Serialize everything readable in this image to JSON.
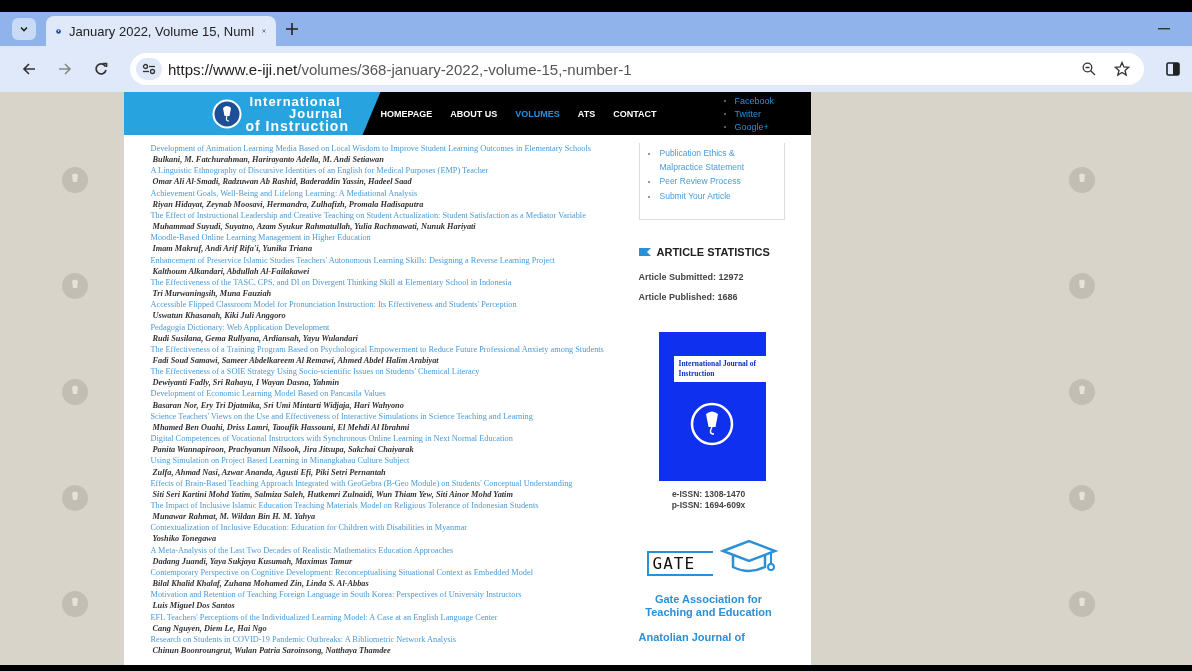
{
  "browser": {
    "tab_title": "January 2022, Volume 15, Numl",
    "url_host": "https://www.e-iji.net",
    "url_path": "/volumes/368-january-2022,-volume-15,-number-1"
  },
  "header": {
    "logo_lines": [
      "International",
      "Journal",
      "of Instruction"
    ],
    "nav": [
      {
        "label": "HOMEPAGE",
        "selected": false
      },
      {
        "label": "ABOUT US",
        "selected": false
      },
      {
        "label": "VOLUMES",
        "selected": true
      },
      {
        "label": "ATS",
        "selected": false
      },
      {
        "label": "CONTACT",
        "selected": false
      }
    ],
    "social": [
      "Facebook",
      "Twitter",
      "Google+"
    ]
  },
  "articles": [
    {
      "title": "Development of Animation Learning Media Based on Local Wisdom to Improve Student Learning Outcomes in Elementary Schools",
      "authors": "Bulkani, M. Fatchurahman, Harirayanto Adella, M. Andi Setiawan"
    },
    {
      "title": "A Linguistic Ethnography of Discursive Identities of an English for Medical Purposes (EMP) Teacher",
      "authors": "Omar Ali Al-Smadi, Radzuwan Ab Rashid, Baderaddin Yassin, Hadeel Saad"
    },
    {
      "title": "Achievement Goals, Well-Being and Lifelong Learning: A Mediational Analysis",
      "authors": "Riyan Hidayat, Zeynab Moosavi, Hermandra, Zulhafizh, Promala Hadisaputra"
    },
    {
      "title": "The Effect of Instructional Leadership and Creative Teaching on Student Actualization: Student Satisfaction as a Mediator Variable",
      "authors": "Muhammad Suyudi, Suyatno, Azam Syukur Rahmatullah, Yulia Rachmawati, Nunuk Hariyati"
    },
    {
      "title": "Moodle-Based Online Learning Management in Higher Education",
      "authors": "Imam Makruf, Andi Arif Rifa'i, Yunika Triana"
    },
    {
      "title": "Enhancement of Preservice Islamic Studies Teachers' Autonomous Learning Skills: Designing a Reverse Learning Project",
      "authors": "Kalthoum Alkandari, Abdullah Al-Failakawei"
    },
    {
      "title": "The Effectiveness of the TASC, CPS, and DI on Divergent Thinking Skill at Elementary School in Indonesia",
      "authors": "Tri Murwaningsih, Muna Fauziah"
    },
    {
      "title": "Accessible Flipped Classroom Model for Pronunciation Instruction: Its Effectiveness and Students' Perception",
      "authors": "Uswatun Khasanah, Kiki Juli Anggoro"
    },
    {
      "title": "Pedagogia Dictionary: Web Application Development",
      "authors": "Rudi Susilana, Gema Rullyana, Ardiansah, Yayu Wulandari"
    },
    {
      "title": "The Effectiveness of a Training Program Based on Psychological Empowerment to Reduce Future Professional Anxiety among Students",
      "authors": "Fadi Soud Samawi, Sameer Abdelkareem Al Remawi, Ahmed Abdel Halim Arabiyat"
    },
    {
      "title": "The Effectiveness of a SOIE Strategy Using Socio-scientific Issues on Students' Chemical Literacy",
      "authors": "Dewiyanti Fadly, Sri Rahayu, I Wayan Dasna, Yahmin"
    },
    {
      "title": "Development of Economic Learning Model Based on Pancasila Values",
      "authors": "Basaran Nor, Ery Tri Djatmika, Sri Umi Mintarti Widjaja, Hari Wahyono"
    },
    {
      "title": "Science Teachers' Views on the Use and Effectiveness of Interactive Simulations in Science Teaching and Learning",
      "authors": "Mhamed Ben Ouahi, Driss Lamri, Taoufik Hassouni, El Mehdi Al Ibrahmi"
    },
    {
      "title": "Digital Competences of Vocational Instructors with Synchronous Online Learning in Next Normal Education",
      "authors": "Panita Wannapiroon, Prachyanun Nilsook, Jira Jitsupa, Sakchai Chaiyarak"
    },
    {
      "title": "Using Simulation on Project Based Learning in Minangkabau Culture Subject",
      "authors": "Zulfa, Ahmad Nasi, Azwar Ananda, Agusti Efi, Piki Setri Pernantah"
    },
    {
      "title": "Effects of Brain-Based Teaching Approach Integrated with GeoGebra (B-Geo Module) on Students' Conceptual Understanding",
      "authors": "Siti Seri Kartini Mohd Yatim, Salmiza Saleh, Hutkemri Zulnaidi, Wun Thiam Yew, Siti Ainor Mohd Yatim"
    },
    {
      "title": "The Impact of Inclusive Islamic Education Teaching Materials Model on Religious Tolerance of Indonesian Students",
      "authors": "Munawar Rahmat, M. Wildan Bin H. M. Yahya"
    },
    {
      "title": "Contextualization of Inclusive Education: Education for Children with Disabilities in Myanmar",
      "authors": "Yoshiko Tonegawa"
    },
    {
      "title": "A Meta-Analysis of the Last Two Decades of Realistic Mathematics Education Approaches",
      "authors": "Dadang Juandi, Yaya Sukjaya Kusumah, Maximus Tamur"
    },
    {
      "title": "Contemporary Perspective on Cognitive Development: Reconceptualising Situational Context as Embedded Model",
      "authors": "Bilal Khalid Khalaf, Zuhana Mohamed Zin, Linda S. Al-Abbas"
    },
    {
      "title": "Motivation and Retention of Teaching Foreign Language in South Korea: Perspectives of University Instructors",
      "authors": "Luis Miguel Dos Santos"
    },
    {
      "title": "EFL Teachers' Perceptions of the Individualized Learning Model: A Case at an English Language Center",
      "authors": "Cang Nguyen, Diem Le, Hai Ngo"
    },
    {
      "title": "Research on Students in COVID-19 Pandemic Outbreaks: A Bibliometric Network Analysis",
      "authors": "Chinun Boonroungrut, Wulan Patria Saroinsong, Natthaya Thamdee"
    }
  ],
  "sidebar": {
    "links": [
      "Publication Ethics & Malpractice Statement",
      "Peer Review Process",
      "Submit Your Article"
    ],
    "stats_heading": "ARTICLE STATISTICS",
    "stats": [
      "Article Submitted: 12972",
      "Article Published: 1686"
    ],
    "cover_title": "International Journal of Instruction",
    "issn": [
      "e-ISSN: 1308-1470",
      "p-ISSN: 1694-609x"
    ],
    "gate_logo": "GATE",
    "gate_name": "Gate Association for Teaching and Education",
    "next_heading": "Anatolian Journal of"
  }
}
